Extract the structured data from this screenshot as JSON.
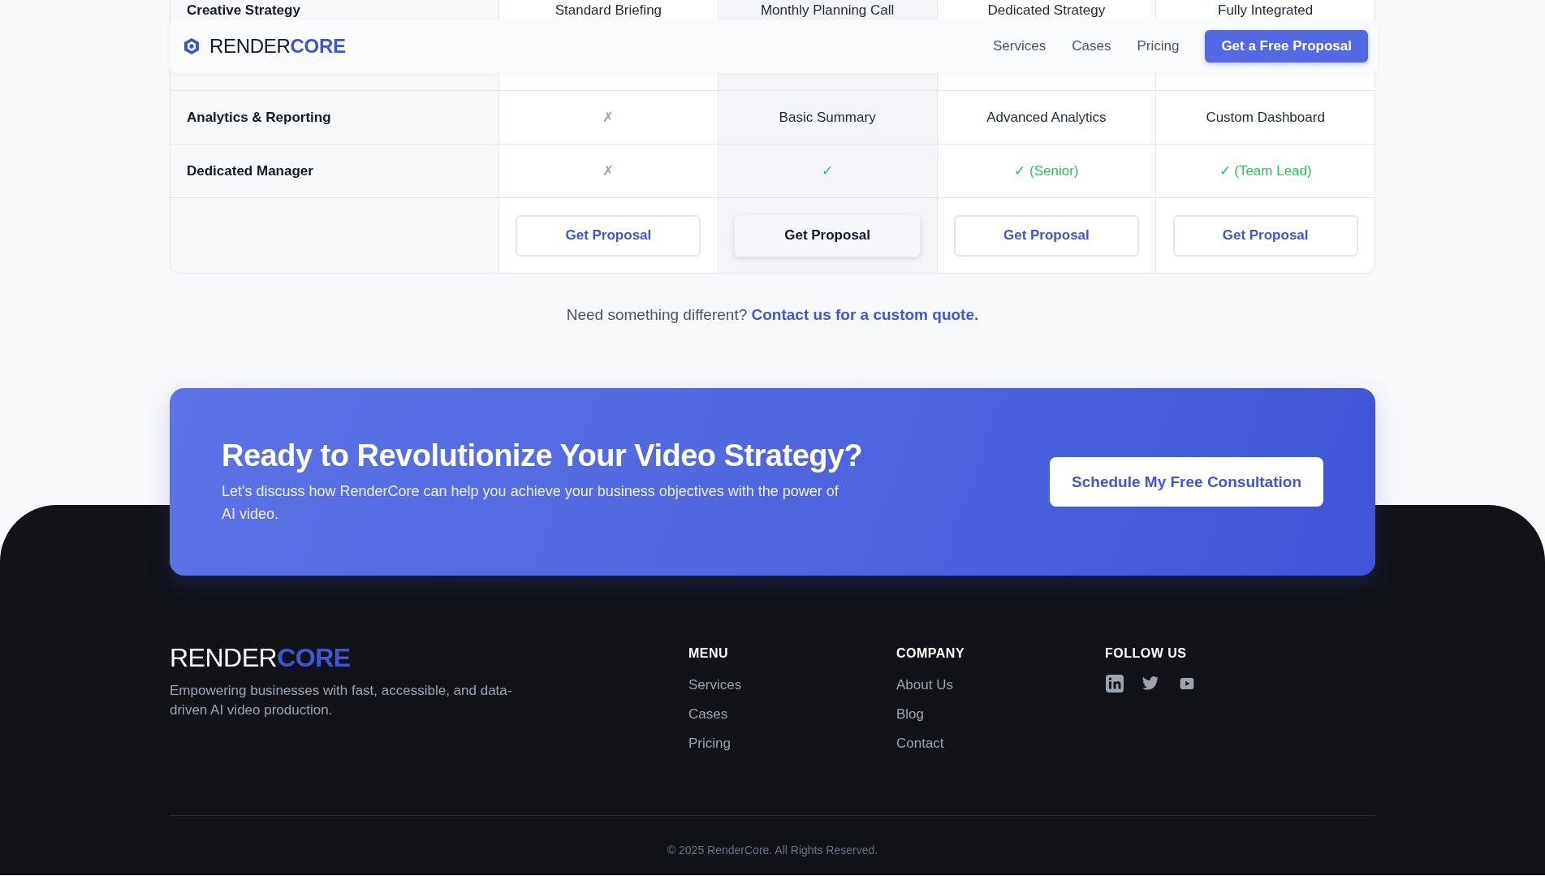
{
  "nav": {
    "logo_text": "RENDER",
    "logo_accent": "CORE",
    "links": [
      "Services",
      "Cases",
      "Pricing"
    ],
    "cta": "Get a Free Proposal"
  },
  "table": {
    "plans": [
      {
        "highlighted": false
      },
      {
        "highlighted": true
      },
      {
        "highlighted": false
      },
      {
        "highlighted": false
      }
    ],
    "rows": [
      {
        "label": "Creative Strategy",
        "cells": [
          {
            "kind": "text",
            "text": "Standard Briefing"
          },
          {
            "kind": "text",
            "text": "Monthly Planning Call"
          },
          {
            "kind": "text",
            "text": "Dedicated Strategy"
          },
          {
            "kind": "text",
            "text": "Fully Integrated"
          }
        ]
      },
      {
        "label": "",
        "cells": []
      },
      {
        "label": "Analytics & Reporting",
        "cells": [
          {
            "kind": "cross",
            "text": "✗"
          },
          {
            "kind": "text",
            "text": "Basic Summary"
          },
          {
            "kind": "text",
            "text": "Advanced Analytics"
          },
          {
            "kind": "text",
            "text": "Custom Dashboard"
          }
        ]
      },
      {
        "label": "Dedicated Manager",
        "cells": [
          {
            "kind": "cross",
            "text": "✗"
          },
          {
            "kind": "check",
            "text": "✓"
          },
          {
            "kind": "check",
            "text": "✓ (Senior)"
          },
          {
            "kind": "check",
            "text": "✓ (Team Lead)"
          }
        ]
      }
    ],
    "buttons": [
      "Get Proposal",
      "Get Proposal",
      "Get Proposal",
      "Get Proposal"
    ]
  },
  "custom_note": {
    "text": "Need something different?",
    "link": "Contact us for a custom quote."
  },
  "cta": {
    "title": "Ready to Revolutionize Your Video Strategy?",
    "text": "Let's discuss how RenderCore can help you achieve your business objectives with the power of AI video.",
    "button": "Schedule My Free Consultation"
  },
  "footer": {
    "logo_text": "RENDER",
    "logo_accent": "CORE",
    "tagline": "Empowering businesses with fast, accessible, and data-driven AI video production.",
    "columns": [
      {
        "title": "MENU",
        "links": [
          "Services",
          "Cases",
          "Pricing"
        ]
      },
      {
        "title": "COMPANY",
        "links": [
          "About Us",
          "Blog",
          "Contact"
        ]
      }
    ],
    "follow_title": "FOLLOW US",
    "social": [
      {
        "kind": "linkedin"
      },
      {
        "kind": "twitter"
      },
      {
        "kind": "youtube"
      }
    ],
    "copyright": "© 2025 RenderCore. All Rights Reserved."
  }
}
